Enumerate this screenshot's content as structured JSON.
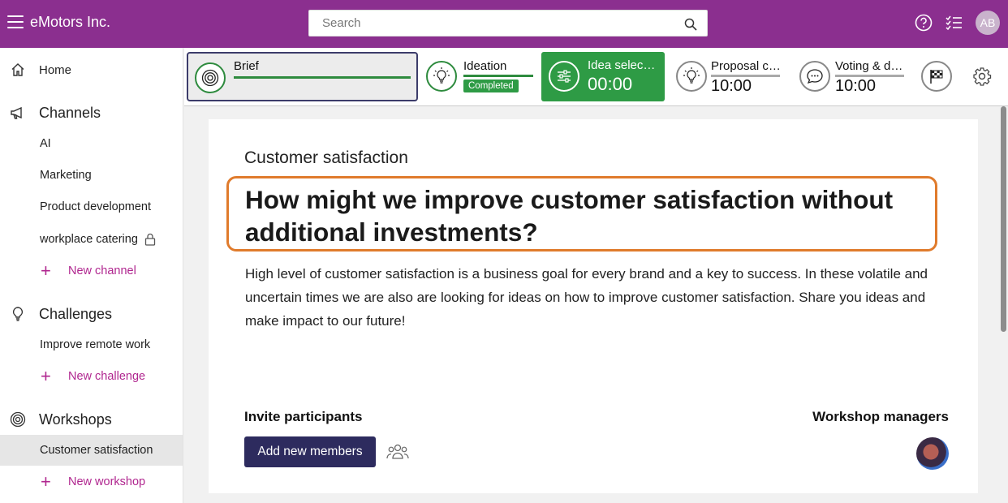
{
  "app": {
    "title": "eMotors Inc."
  },
  "search": {
    "placeholder": "Search"
  },
  "user": {
    "initials": "AB"
  },
  "sidebar": {
    "home": "Home",
    "channels": {
      "label": "Channels",
      "items": [
        "AI",
        "Marketing",
        "Product development",
        "workplace catering"
      ],
      "new_label": "New channel"
    },
    "challenges": {
      "label": "Challenges",
      "items": [
        "Improve remote work"
      ],
      "new_label": "New challenge"
    },
    "workshops": {
      "label": "Workshops",
      "items": [
        "Customer satisfaction"
      ],
      "new_label": "New workshop"
    }
  },
  "stages": {
    "brief": {
      "name": "Brief"
    },
    "ideation": {
      "name": "Ideation",
      "status": "Completed"
    },
    "idea_selection": {
      "name": "Idea selec…",
      "time": "00:00"
    },
    "proposal": {
      "name": "Proposal c…",
      "time": "10:00"
    },
    "voting": {
      "name": "Voting & d…",
      "time": "10:00"
    }
  },
  "brief": {
    "subtitle": "Customer satisfaction",
    "question": "How might we improve customer satisfaction without additional investments?",
    "description": "High level of customer satisfaction is a business goal for every brand and a key to success. In these volatile and uncertain times we are also are looking for ideas on how to improve customer satisfaction. Share you ideas and make impact to our future!",
    "invite_title": "Invite participants",
    "add_button": "Add new members",
    "managers_title": "Workshop managers"
  },
  "colors": {
    "brand": "#8b2f8f",
    "accent_pink": "#b0268f",
    "stage_green": "#2e9b45",
    "highlight_orange": "#e07b2c",
    "button_navy": "#2d2b5e"
  }
}
